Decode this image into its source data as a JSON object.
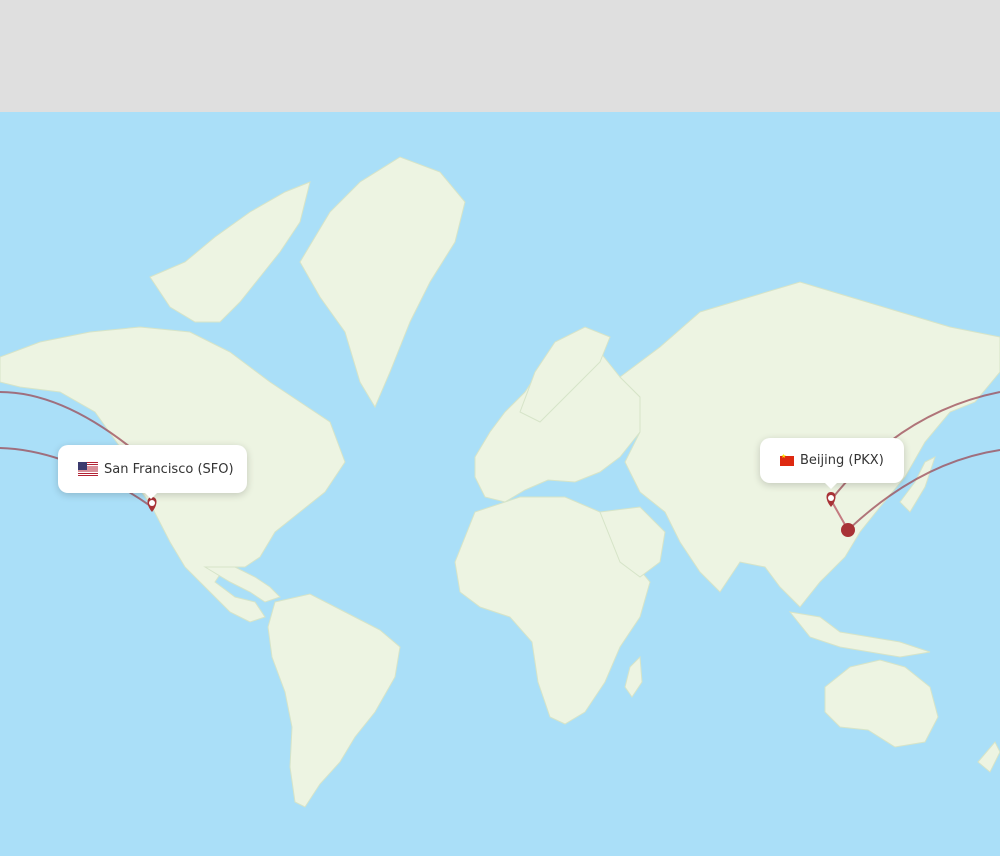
{
  "map": {
    "origin": {
      "city": "San Francisco",
      "code": "SFO",
      "label": "San Francisco (SFO)",
      "flag": "us-flag"
    },
    "destination": {
      "city": "Beijing",
      "code": "PKX",
      "label": "Beijing (PKX)",
      "flag": "cn-flag"
    }
  },
  "colors": {
    "ocean": "#aadff8",
    "land": "#edf4e2",
    "route": "#9b4a55",
    "marker": "#a83236",
    "header_band": "#dfdfdf"
  }
}
